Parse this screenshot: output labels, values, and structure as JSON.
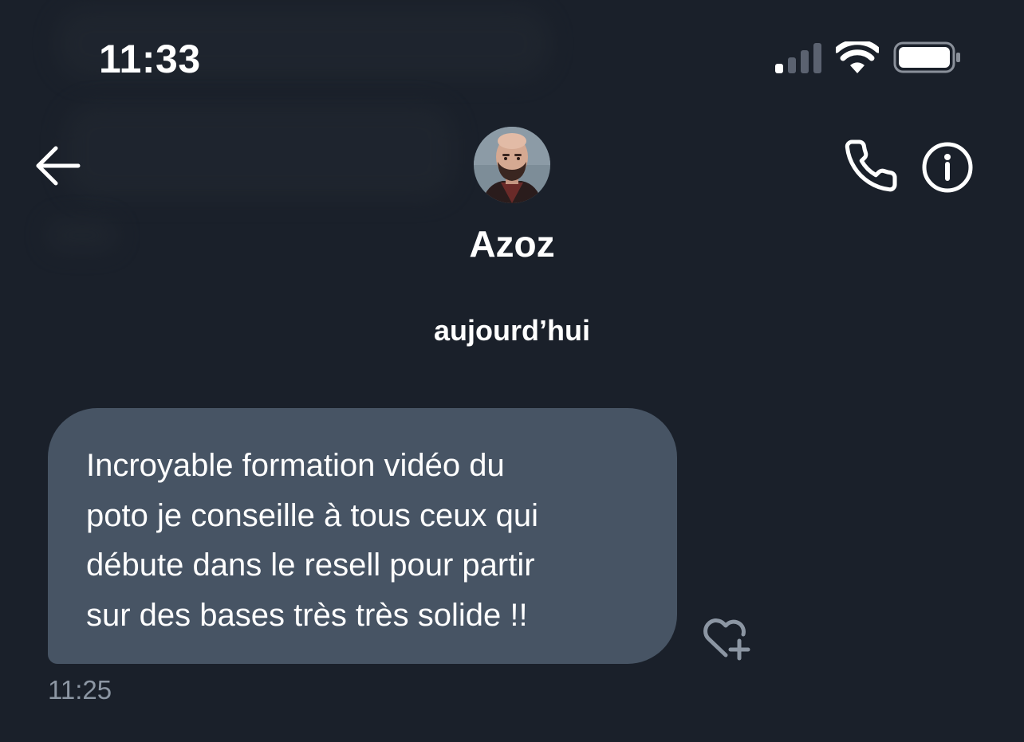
{
  "status_bar": {
    "time": "11:33",
    "signal_icon": "cellular-signal-icon",
    "wifi_icon": "wifi-icon",
    "battery_icon": "battery-icon"
  },
  "header": {
    "back_icon": "back-arrow-icon",
    "contact_name": "Azoz",
    "call_icon": "phone-icon",
    "info_icon": "info-icon"
  },
  "conversation": {
    "date_separator": "aujourd’hui",
    "messages": [
      {
        "lines": [
          "Incroyable formation vidéo du",
          "poto je conseille à tous ceux qui",
          "débute dans le resell pour partir",
          "sur des bases très très solide !!"
        ],
        "time": "11:25",
        "reaction_icon": "heart-plus-icon"
      }
    ]
  },
  "colors": {
    "background": "#1a202a",
    "bubble": "#475464",
    "text": "#ffffff",
    "muted": "#8c96a3"
  }
}
